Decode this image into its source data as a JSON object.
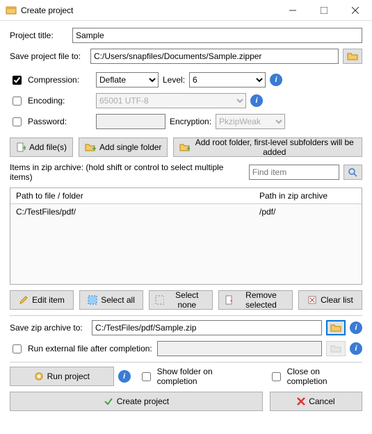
{
  "window": {
    "title": "Create project"
  },
  "project": {
    "title_label": "Project title:",
    "title_value": "Sample"
  },
  "savefile": {
    "label": "Save project file to:",
    "value": "C:/Users/snapfiles/Documents/Sample.zipper"
  },
  "compression": {
    "label": "Compression:",
    "method": "Deflate",
    "level_label": "Level:",
    "level_value": "6"
  },
  "encoding": {
    "label": "Encoding:",
    "value": "65001 UTF-8"
  },
  "password": {
    "label": "Password:",
    "enc_label": "Encryption:",
    "enc_value": "PkzipWeak"
  },
  "buttons": {
    "add_files": "Add file(s)",
    "add_single_folder": "Add single folder",
    "add_root_folder": "Add root folder, first-level subfolders will be added",
    "edit_item": "Edit item",
    "select_all": "Select all",
    "select_none": "Select none",
    "remove_selected": "Remove selected",
    "clear_list": "Clear list",
    "run_project": "Run project",
    "create_project": "Create project",
    "cancel": "Cancel"
  },
  "items": {
    "label": "Items in zip archive: (hold shift or control to select multiple items)",
    "find_placeholder": "Find item",
    "col1": "Path to file / folder",
    "col2": "Path in zip archive",
    "rows": [
      {
        "path": "C:/TestFiles/pdf/",
        "zip": "/pdf/"
      }
    ]
  },
  "savezip": {
    "label": "Save zip archive to:",
    "value": "C:/TestFiles/pdf/Sample.zip"
  },
  "runext": {
    "label": "Run external file after completion:"
  },
  "footer": {
    "show_folder": "Show folder on completion",
    "close_on": "Close on completion"
  }
}
